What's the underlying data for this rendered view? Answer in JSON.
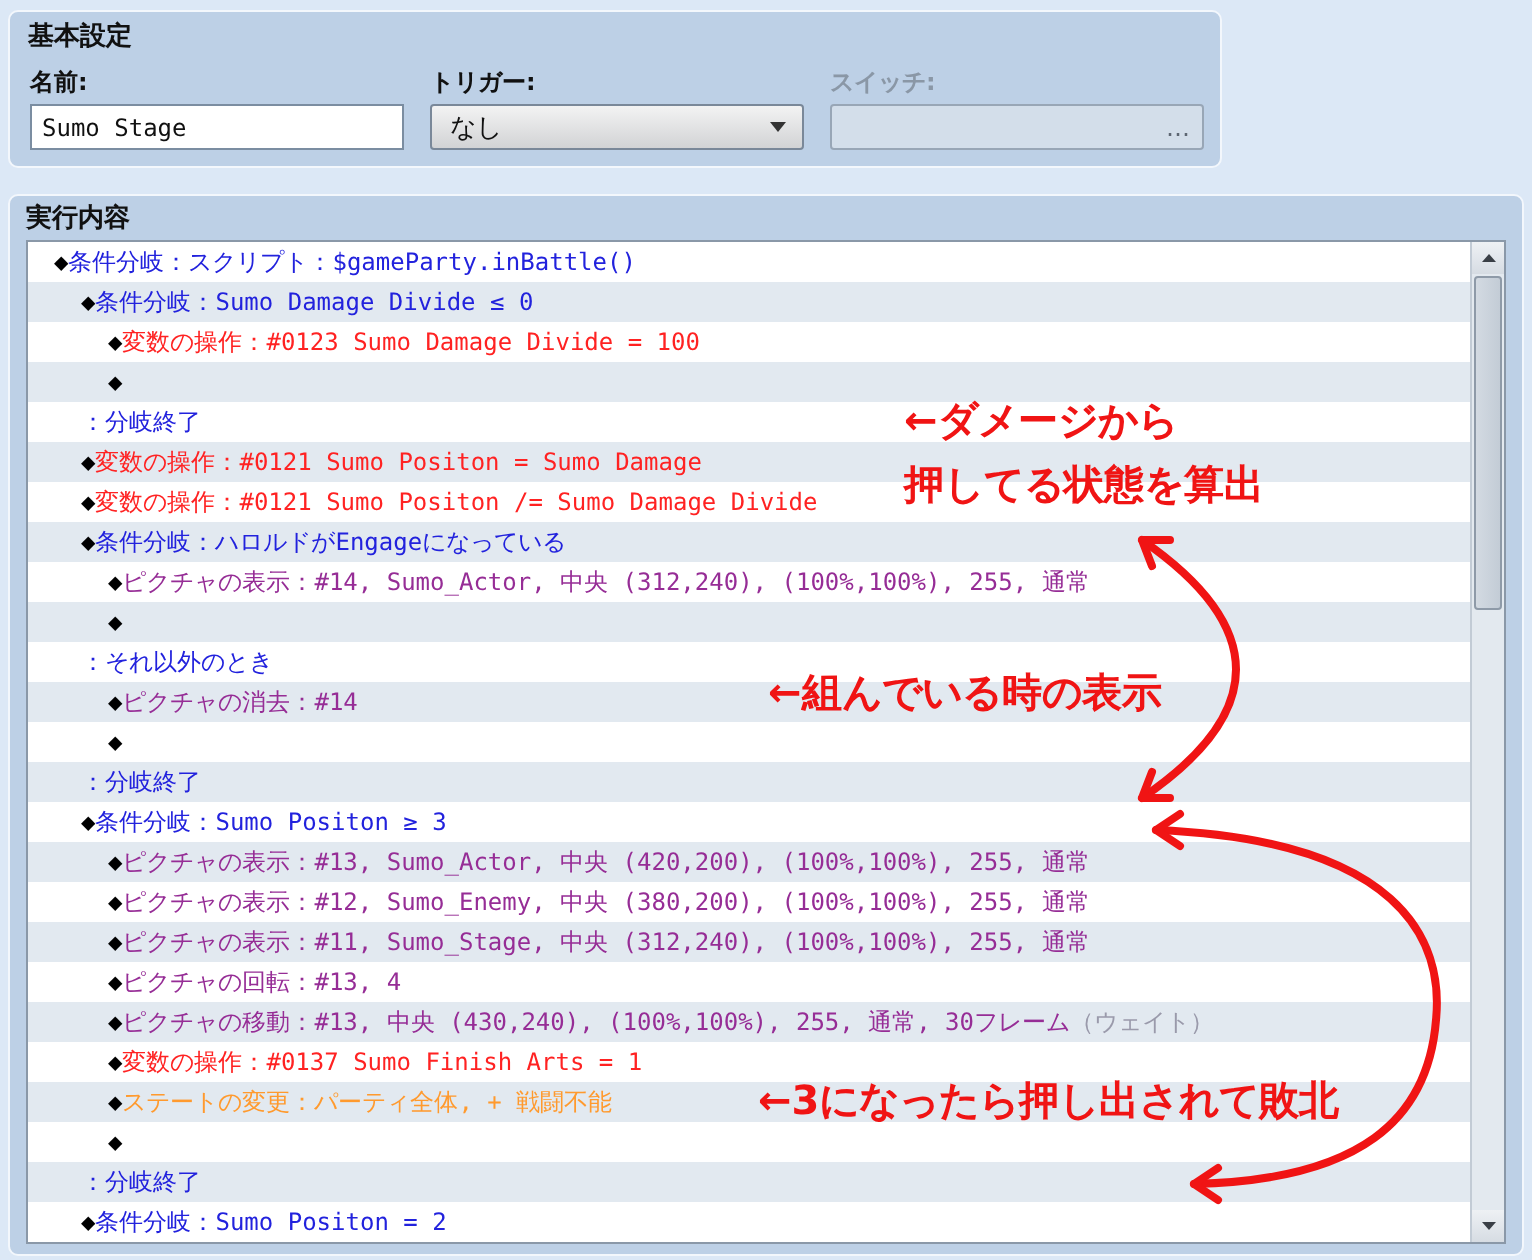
{
  "basic_settings": {
    "title": "基本設定",
    "name": {
      "label": "名前:",
      "value": "Sumo Stage"
    },
    "trigger": {
      "label": "トリガー:",
      "value": "なし"
    },
    "switch": {
      "label": "スイッチ:",
      "button": "…",
      "disabled": true
    }
  },
  "contents": {
    "title": "実行内容",
    "commands": [
      {
        "kind": "command",
        "marker": "◆",
        "text": "条件分岐：スクリプト：$gameParty.inBattle()",
        "color": "#2222dd",
        "selected": false,
        "children": [
          {
            "kind": "command",
            "marker": "◆",
            "text": "条件分岐：Sumo Damage Divide ≤ 0",
            "color": "#2222dd",
            "selected": false,
            "children": [
              {
                "kind": "command",
                "marker": "◆",
                "text": "変数の操作：#0123 Sumo Damage Divide = 100",
                "color": "#ff2222",
                "selected": false
              },
              {
                "kind": "empty",
                "marker": "◆",
                "selected": false
              }
            ]
          },
          {
            "kind": "label",
            "text": "：分岐終了",
            "color": "#2222dd",
            "selected": false
          },
          {
            "kind": "command",
            "marker": "◆",
            "text": "変数の操作：#0121 Sumo Positon = Sumo Damage",
            "color": "#ff2222",
            "selected": false
          },
          {
            "kind": "command",
            "marker": "◆",
            "text": "変数の操作：#0121 Sumo Positon /= Sumo Damage Divide",
            "color": "#ff2222",
            "selected": false
          },
          {
            "kind": "command",
            "marker": "◆",
            "text": "条件分岐：ハロルドがEngageになっている",
            "color": "#2222dd",
            "selected": false,
            "children": [
              {
                "kind": "command",
                "marker": "◆",
                "text": "ピクチャの表示：#14, Sumo_Actor, 中央 (312,240), (100%,100%), 255, 通常",
                "color": "#962d96",
                "selected": false
              },
              {
                "kind": "empty",
                "marker": "◆",
                "selected": false
              }
            ]
          },
          {
            "kind": "label",
            "text": "：それ以外のとき",
            "color": "#2222dd",
            "selected": false,
            "children": [
              {
                "kind": "command",
                "marker": "◆",
                "text": "ピクチャの消去：#14",
                "color": "#962d96",
                "selected": false
              },
              {
                "kind": "empty",
                "marker": "◆",
                "selected": false
              }
            ]
          },
          {
            "kind": "label",
            "text": "：分岐終了",
            "color": "#2222dd",
            "selected": false
          },
          {
            "kind": "command",
            "marker": "◆",
            "text": "条件分岐：Sumo Positon ≥ 3",
            "color": "#2222dd",
            "selected": false,
            "children": [
              {
                "kind": "command",
                "marker": "◆",
                "text": "ピクチャの表示：#13, Sumo_Actor, 中央 (420,200), (100%,100%), 255, 通常",
                "color": "#962d96",
                "selected": false
              },
              {
                "kind": "command",
                "marker": "◆",
                "text": "ピクチャの表示：#12, Sumo_Enemy, 中央 (380,200), (100%,100%), 255, 通常",
                "color": "#962d96",
                "selected": false
              },
              {
                "kind": "command",
                "marker": "◆",
                "text": "ピクチャの表示：#11, Sumo_Stage, 中央 (312,240), (100%,100%), 255, 通常",
                "color": "#962d96",
                "selected": false
              },
              {
                "kind": "command",
                "marker": "◆",
                "text": "ピクチャの回転：#13, 4",
                "color": "#962d96",
                "selected": false
              },
              {
                "kind": "command",
                "marker": "◆",
                "text": "ピクチャの移動：#13, 中央 (430,240), (100%,100%), 255, 通常, 30フレーム",
                "note": "（ウェイト）",
                "color": "#962d96",
                "selected": false
              },
              {
                "kind": "command",
                "marker": "◆",
                "text": "変数の操作：#0137 Sumo Finish Arts = 1",
                "color": "#ff2222",
                "selected": false
              },
              {
                "kind": "command",
                "marker": "◆",
                "text": "ステートの変更：パーティ全体, + 戦闘不能",
                "color": "#ff9a2e",
                "selected": false
              },
              {
                "kind": "empty",
                "marker": "◆",
                "selected": false
              }
            ]
          },
          {
            "kind": "label",
            "text": "：分岐終了",
            "color": "#2222dd",
            "selected": false
          },
          {
            "kind": "command",
            "marker": "◆",
            "text": "条件分岐：Sumo Positon = 2",
            "color": "#2222dd",
            "selected": false
          }
        ]
      }
    ]
  },
  "annotations": [
    {
      "lines": [
        "←ダメージから",
        "押してる状態を算出"
      ]
    },
    {
      "lines": [
        "←組んでいる時の表示"
      ]
    },
    {
      "lines": [
        "←3になったら押し出されて敗北"
      ]
    }
  ]
}
